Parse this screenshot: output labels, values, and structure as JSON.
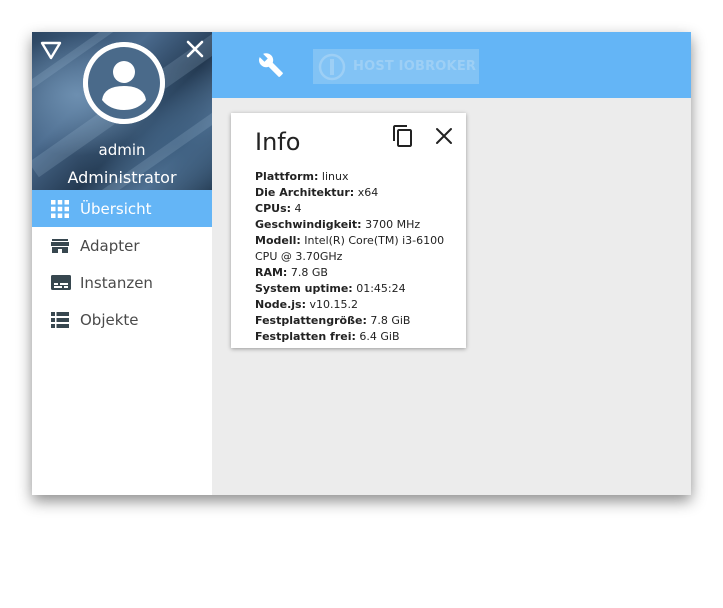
{
  "sidebar": {
    "user": {
      "name": "admin",
      "role": "Administrator"
    },
    "items": [
      {
        "label": "Übersicht",
        "icon": "apps-grid-icon",
        "active": true
      },
      {
        "label": "Adapter",
        "icon": "store-icon",
        "active": false
      },
      {
        "label": "Instanzen",
        "icon": "instances-icon",
        "active": false
      },
      {
        "label": "Objekte",
        "icon": "list-icon",
        "active": false
      }
    ]
  },
  "toolbar": {
    "host_label": "HOST IOBROKER"
  },
  "info_card": {
    "title": "Info",
    "rows": [
      {
        "key": "Plattform:",
        "value": "linux"
      },
      {
        "key": "Die Architektur:",
        "value": "x64"
      },
      {
        "key": "CPUs:",
        "value": "4"
      },
      {
        "key": "Geschwindigkeit:",
        "value": "3700 MHz"
      },
      {
        "key": "Modell:",
        "value": "Intel(R) Core(TM) i3-6100 CPU @ 3.70GHz"
      },
      {
        "key": "RAM:",
        "value": "7.8 GB"
      },
      {
        "key": "System uptime:",
        "value": "01:45:24"
      },
      {
        "key": "Node.js:",
        "value": "v10.15.2"
      },
      {
        "key": "Festplattengröße:",
        "value": "7.8 GiB"
      },
      {
        "key": "Festplatten frei:",
        "value": "6.4 GiB"
      }
    ]
  },
  "colors": {
    "accent": "#64b5f6",
    "content_bg": "#ececec"
  }
}
